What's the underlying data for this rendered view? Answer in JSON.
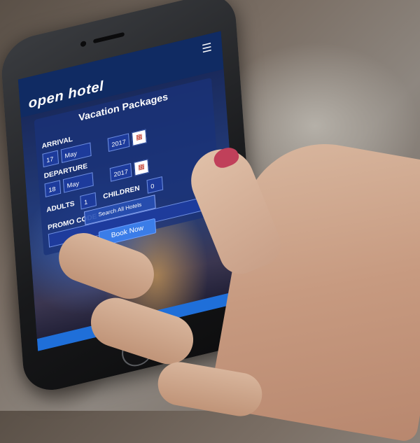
{
  "header": {
    "logo": "open hotel",
    "menu_icon": "hamburger-menu-icon"
  },
  "panel": {
    "title": "Vacation Packages",
    "arrival_label": "ARRIVAL",
    "arrival_day": "17",
    "arrival_month": "May",
    "arrival_year": "2017",
    "departure_label": "DEPARTURE",
    "departure_day": "18",
    "departure_month": "May",
    "departure_year": "2017",
    "adults_label": "ADULTS",
    "adults_value": "1",
    "children_label": "CHILDREN",
    "children_value": "0",
    "promo_label": "PROMO CODE",
    "promo_value": "",
    "search_select": "Search All Hotels",
    "book_button": "Book Now"
  },
  "colors": {
    "header_bg": "#102b63",
    "book_button": "#3b7de8",
    "bottom_bar": "#1f6fd9"
  }
}
